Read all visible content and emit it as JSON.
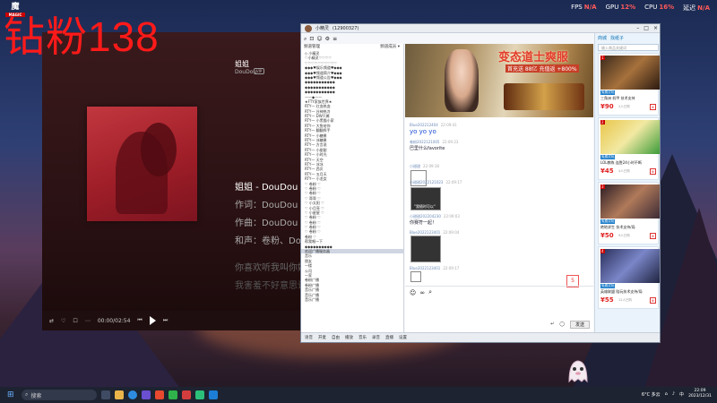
{
  "overlay": {
    "fps_label": "FPS",
    "fps_value": "N/A",
    "gpu_label": "GPU",
    "gpu_value": "12%",
    "cpu_label": "CPU",
    "cpu_value": "16%",
    "latency_label": "延迟",
    "latency_value": "N/A"
  },
  "watermark": "钻粉138",
  "brand": {
    "logo_text": "魔",
    "logo_sub": "MAGIC"
  },
  "player": {
    "song": "姐姐",
    "artist": "DouDou",
    "vip": "VIP",
    "lyrics": [
      "姐姐 - DouDou",
      "作词：DouDou",
      "作曲：DouDou",
      "和声：卷粉、DouDou",
      "你喜欢听我叫你姐姐",
      "我害羞不好意思说出来"
    ],
    "time": "00:00/02:54"
  },
  "chat": {
    "title": "小精灵",
    "channel_id": "(12900327)",
    "tree_header": "频道管理",
    "tree_header_right": "频道成员 ▾",
    "tree_rows": [
      "◇ 小精灵",
      "♡小精灵♡♡♡♡",
      "♡♡♡♡♡♡♡♡♡♡",
      "◆◆◆♥娱乐频道♥◆◆◆",
      "◆◆◆♥频道简介♥◆◆◆",
      "◆◆◆♥频道公告♥◆◆◆",
      "◆◆◆◆◆◆◆◆◆◆◆",
      "◆◆◆◆◆◆◆◆◆◆◆",
      "◆◆◆◆◆◆◆◆◆◆◆",
      "——◆——",
      "★FTY家族世界★",
      "RTY一 红血热血",
      "RTY一 谷神热冷",
      "RTY一 DW只酱",
      "RTY一 小黑猫小家",
      "RTY一 大鱼给你",
      "RTY一 翻翻挥手",
      "RTY一 小糖果",
      "RTY一 冰糖果",
      "RTY一 方言说",
      "RTY一 小甜甜",
      "RTY一 小时光",
      "RTY一 天空",
      "RTY一 冰冰",
      "RTY一 西贝",
      "RTY一 五月天",
      "RTY一 小龙女",
      "♡ 卷粉 ♡",
      "♡ 卷粉 ♡",
      "♡ 卷粉 ♡",
      "♡ 哥哥 ♡",
      "♡ 小太阳 ♡",
      "♡ 小月亮 ♡",
      "♡ 小星星 ♡",
      "♡ 卷粉 ♡",
      "♡ 卷粉 ♡",
      "♡ 卷粉 ♡",
      "♡ 卷粉 ♡",
      "卷粉 ♡",
      "帮我唱一下",
      "◆◆◆◆◆◆◆◆◆◆",
      "欢迎广播服务器",
      "音乐",
      "朋友",
      "一楼",
      "公司",
      "一家",
      "卷粉广播",
      "卷粉广播",
      "音乐广播",
      "音乐广播",
      "音乐广播"
    ],
    "selected_row": "欢迎广播服务器",
    "banner_title": "变态道士爽服",
    "banner_sub": "首充送 88亿 充值返 +800%",
    "messages": [
      {
        "user": "Blue202212404",
        "time": "22:09:41",
        "text": "yo yo yo"
      },
      {
        "user": "卷粉2022121005",
        "time": "22:09:23",
        "text": "巴里什么favorite"
      },
      {
        "user": "小甜甜",
        "time": "22:09:18",
        "text": ""
      },
      {
        "user": "小甜甜2022121023",
        "time": "22:09:17",
        "text": ""
      },
      {
        "user": "小甜甜202204230",
        "time": "22:09:03",
        "text": "你赛符一起！"
      },
      {
        "user": "Blue2022123401",
        "time": "22:09:04",
        "text": ""
      },
      {
        "user": "Blue2022123401",
        "time": "22:09:17",
        "text": ""
      }
    ],
    "sticker_caption": "\"我随时可以\"",
    "send_label": "发送",
    "bottom_items": [
      "语音",
      "开麦",
      "自由",
      "播放",
      "音乐",
      "录音",
      "直播",
      "设置"
    ]
  },
  "shop": {
    "tab_shop": "商城",
    "tab_other": "找纸子",
    "search_placeholder": "输入商品关键词",
    "cards": [
      {
        "rank": "1",
        "tag": "免费试玩",
        "title": "三角洲 机甲 技术支持",
        "price": "¥90",
        "sold": "2人已购"
      },
      {
        "rank": "2",
        "tag": "免费试玩",
        "title": "LOL教练 连胜24小时不断",
        "price": "¥45",
        "sold": "4人已购"
      },
      {
        "rank": "3",
        "tag": "免费试玩",
        "title": "绝地求生 技术支持/局",
        "price": "¥50",
        "sold": "9人已购"
      },
      {
        "rank": "4",
        "tag": "免费试玩",
        "title": "英雄联盟 陪玩技术支持/局",
        "price": "¥55",
        "sold": "12人已购"
      }
    ]
  },
  "taskbar": {
    "search_text": "搜索",
    "weather": "6°C 多云",
    "lang": "中",
    "time": "22:09",
    "date": "2023/12/31"
  }
}
